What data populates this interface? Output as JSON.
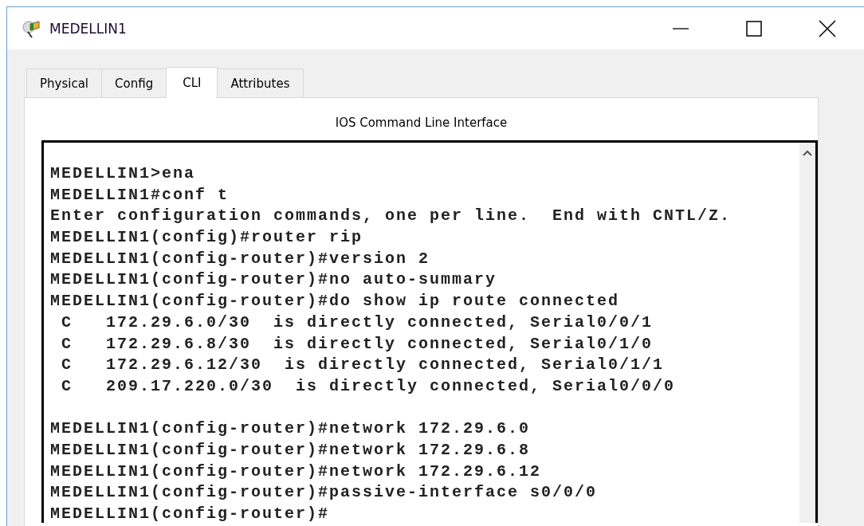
{
  "window": {
    "title": "MEDELLIN1"
  },
  "tabs": [
    {
      "label": "Physical",
      "selected": false
    },
    {
      "label": "Config",
      "selected": false
    },
    {
      "label": "CLI",
      "selected": true
    },
    {
      "label": "Attributes",
      "selected": false
    }
  ],
  "cli": {
    "heading": "IOS Command Line Interface",
    "blocks": [
      [
        "MEDELLIN1>ena",
        "MEDELLIN1#conf t",
        "Enter configuration commands, one per line.  End with CNTL/Z.",
        "MEDELLIN1(config)#router rip",
        "MEDELLIN1(config-router)#version 2",
        "MEDELLIN1(config-router)#no auto-summary",
        "MEDELLIN1(config-router)#do show ip route connected",
        " C   172.29.6.0/30  is directly connected, Serial0/0/1",
        " C   172.29.6.8/30  is directly connected, Serial0/1/0",
        " C   172.29.6.12/30  is directly connected, Serial0/1/1",
        " C   209.17.220.0/30  is directly connected, Serial0/0/0"
      ],
      [
        "MEDELLIN1(config-router)#network 172.29.6.0",
        "MEDELLIN1(config-router)#network 172.29.6.8",
        "MEDELLIN1(config-router)#network 172.29.6.12",
        "MEDELLIN1(config-router)#passive-interface s0/0/0",
        "MEDELLIN1(config-router)#"
      ]
    ]
  }
}
